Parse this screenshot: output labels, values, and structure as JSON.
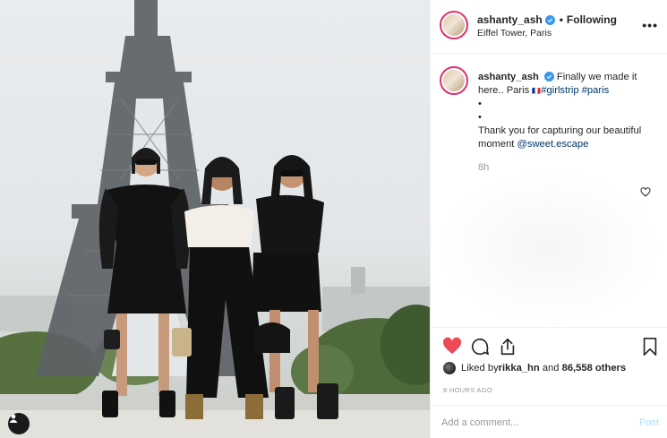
{
  "post": {
    "header": {
      "username": "ashanty_ash",
      "separator": "•",
      "follow_state": "Following",
      "location": "Eiffel Tower, Paris",
      "more_label": "•••"
    },
    "caption": {
      "username": "ashanty_ash",
      "line1": "Finally we made it here.. Paris ",
      "flag": "🇫🇷",
      "hashtag1": "#girlstrip",
      "hashtag2": "#paris",
      "bullet1": "•",
      "bullet2": "•",
      "line2": "Thank you for capturing our beautiful moment ",
      "mention": "@sweet.escape",
      "time_ago": "8h"
    },
    "likes": {
      "prefix": "Liked by ",
      "user": "rikka_hn",
      "middle": " and ",
      "count": "86,558 others"
    },
    "timestamp": "8 HOURS AGO",
    "comment": {
      "placeholder": "Add a comment...",
      "post_label": "Post"
    },
    "liked": true,
    "icons": {
      "like": "heart-icon",
      "comment": "comment-icon",
      "share": "share-icon",
      "save": "bookmark-icon",
      "verified": "verified-badge-icon",
      "user_tags": "user-tag-icon"
    },
    "colors": {
      "like_red": "#ed4956",
      "link_blue": "#003569",
      "verified_blue": "#3897f0",
      "post_disabled": "#b2dffc",
      "muted": "#999999"
    }
  }
}
